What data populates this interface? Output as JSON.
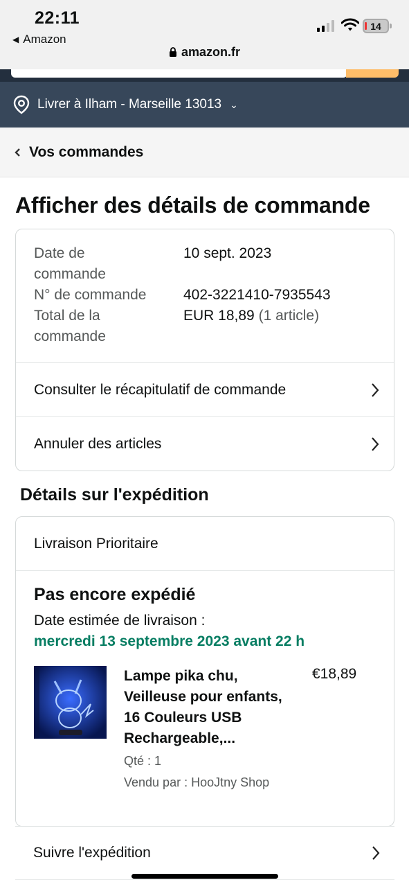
{
  "status_bar": {
    "time": "22:11",
    "back_app": "Amazon",
    "url": "amazon.fr",
    "battery": "14"
  },
  "deliver_bar": {
    "text": "Livrer à Ilham - Marseille 13013"
  },
  "breadcrumb": {
    "label": "Vos commandes"
  },
  "page_title": "Afficher des détails de commande",
  "order_info": {
    "date_label": "Date de commande",
    "date_value": "10 sept. 2023",
    "number_label": "N° de commande",
    "number_value": "402-3221410-7935543",
    "total_label": "Total de la commande",
    "total_value": "EUR 18,89",
    "total_count": "(1 article)"
  },
  "actions": {
    "summary": "Consulter le récapitulatif de commande",
    "cancel": "Annuler des articles"
  },
  "shipment": {
    "section_title": "Détails sur l'expédition",
    "method": "Livraison Prioritaire",
    "status": "Pas encore expédié",
    "estimate_label": "Date estimée de livraison :",
    "estimate_date": "mercredi 13 septembre 2023 avant 22 h",
    "item": {
      "title": "Lampe pika chu, Veilleuse pour enfants, 16 Couleurs USB Rechargeable,...",
      "qty": "Qté : 1",
      "seller": "Vendu par : HooJtny Shop",
      "price": "€18,89"
    },
    "track_label": "Suivre l'expédition"
  },
  "colors": {
    "header_dark": "#37475a",
    "delivery_green": "#067d62",
    "search_button": "#febd69"
  }
}
